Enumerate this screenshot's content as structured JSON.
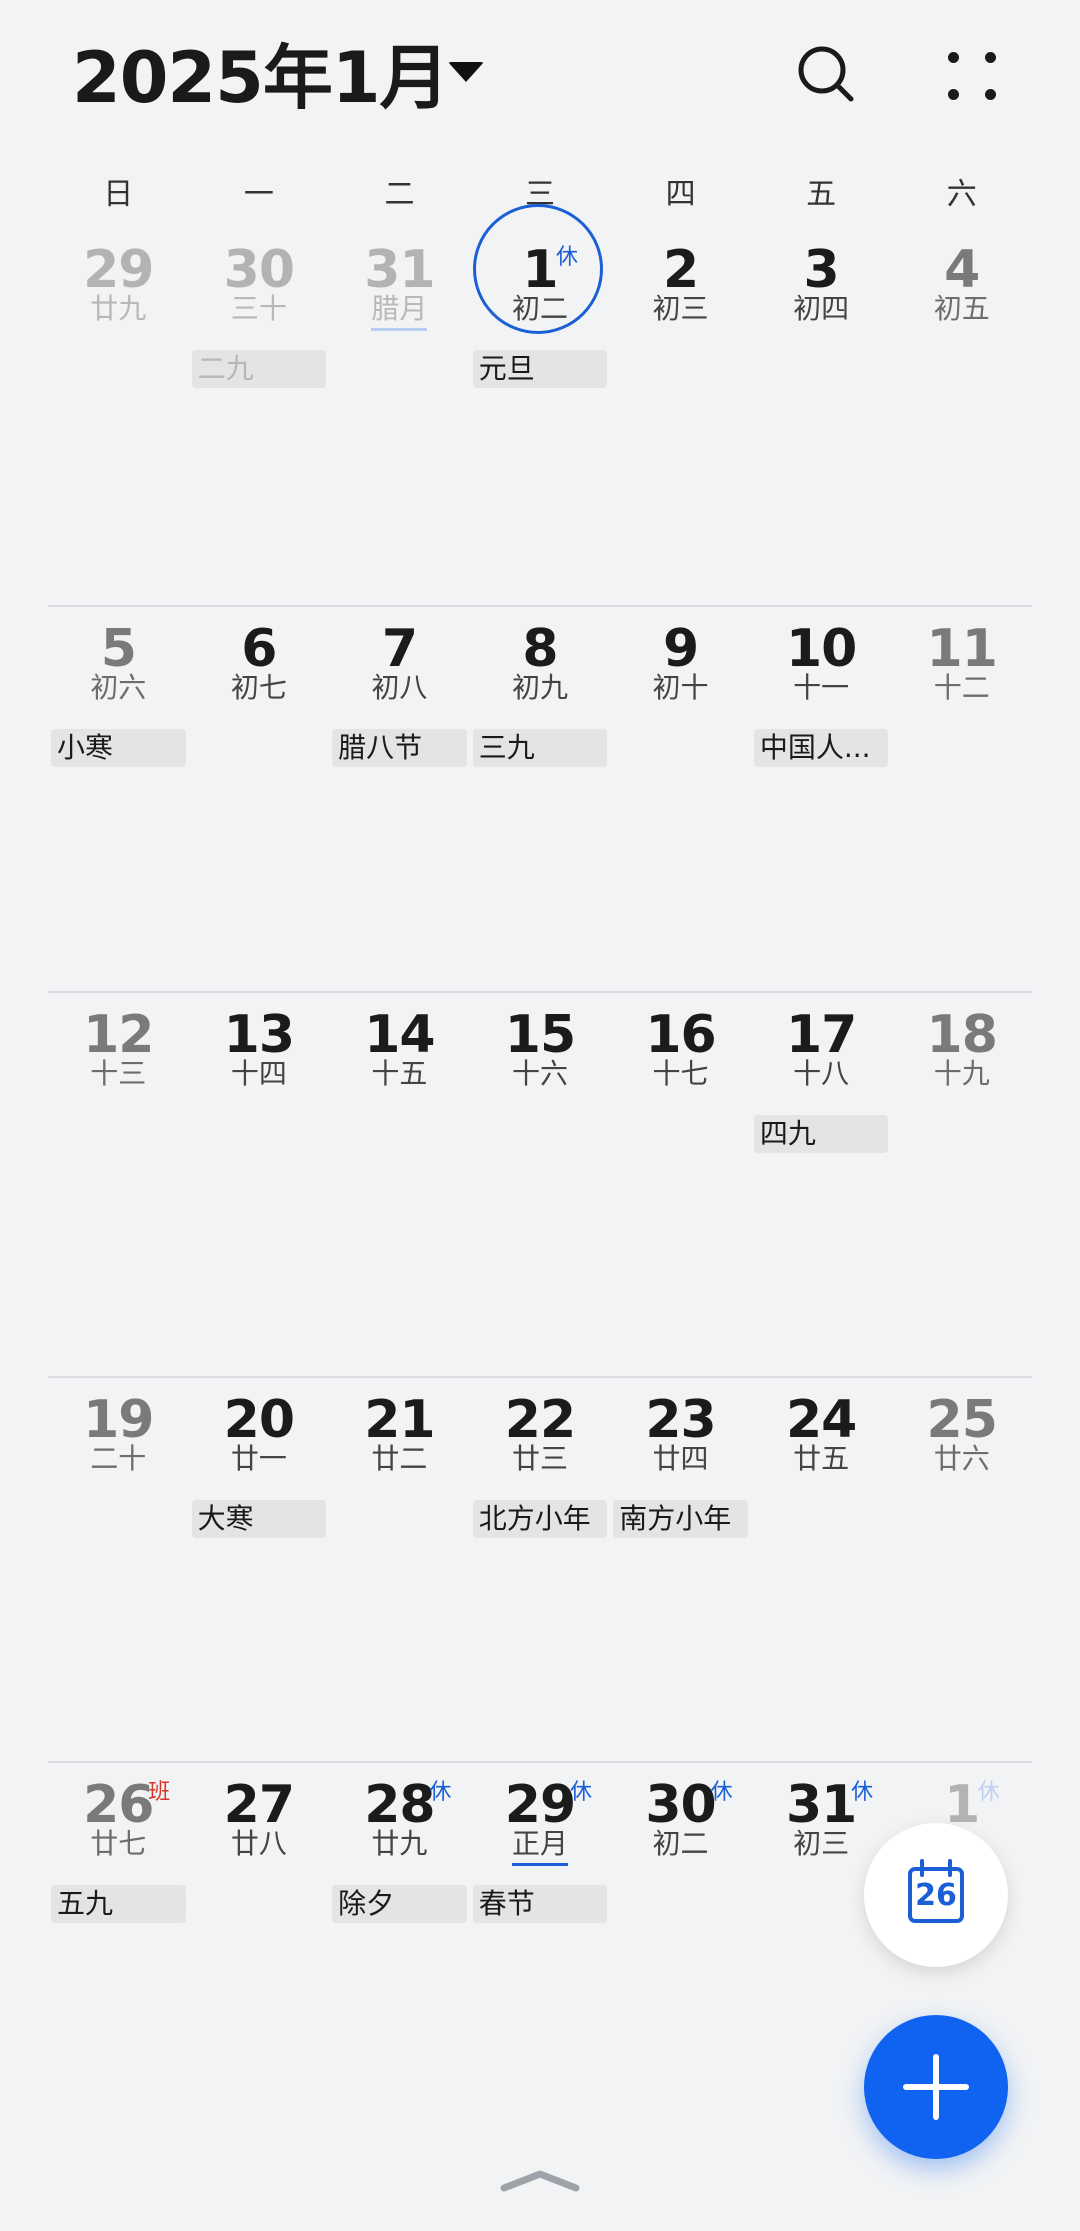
{
  "header": {
    "title": "2025年1月",
    "dropdown_icon": "triangle-down-icon",
    "search_icon": "search-icon",
    "more_icon": "four-dots-icon"
  },
  "weekdays": [
    "日",
    "一",
    "二",
    "三",
    "四",
    "五",
    "六"
  ],
  "weeks": [
    {
      "days": [
        {
          "num": "29",
          "lunar": "廿九",
          "dim": true
        },
        {
          "num": "30",
          "lunar": "三十",
          "dim": true
        },
        {
          "num": "31",
          "lunar": "腊月",
          "dim": true,
          "lunar_underline": "light"
        },
        {
          "num": "1",
          "lunar": "初二",
          "badge": "休",
          "today": true
        },
        {
          "num": "2",
          "lunar": "初三"
        },
        {
          "num": "3",
          "lunar": "初四"
        },
        {
          "num": "4",
          "lunar": "初五",
          "weekend": true
        }
      ],
      "events": [
        {
          "col": 1,
          "label": "二九",
          "dim": true
        },
        {
          "col": 3,
          "label": "元旦"
        }
      ]
    },
    {
      "days": [
        {
          "num": "5",
          "lunar": "初六",
          "weekend": true
        },
        {
          "num": "6",
          "lunar": "初七"
        },
        {
          "num": "7",
          "lunar": "初八"
        },
        {
          "num": "8",
          "lunar": "初九"
        },
        {
          "num": "9",
          "lunar": "初十"
        },
        {
          "num": "10",
          "lunar": "十一"
        },
        {
          "num": "11",
          "lunar": "十二",
          "weekend": true
        }
      ],
      "events": [
        {
          "col": 0,
          "label": "小寒"
        },
        {
          "col": 2,
          "label": "腊八节"
        },
        {
          "col": 3,
          "label": "三九"
        },
        {
          "col": 5,
          "label": "中国人..."
        }
      ]
    },
    {
      "days": [
        {
          "num": "12",
          "lunar": "十三",
          "weekend": true
        },
        {
          "num": "13",
          "lunar": "十四"
        },
        {
          "num": "14",
          "lunar": "十五"
        },
        {
          "num": "15",
          "lunar": "十六"
        },
        {
          "num": "16",
          "lunar": "十七"
        },
        {
          "num": "17",
          "lunar": "十八"
        },
        {
          "num": "18",
          "lunar": "十九",
          "weekend": true
        }
      ],
      "events": [
        {
          "col": 5,
          "label": "四九"
        }
      ]
    },
    {
      "days": [
        {
          "num": "19",
          "lunar": "二十",
          "weekend": true
        },
        {
          "num": "20",
          "lunar": "廿一"
        },
        {
          "num": "21",
          "lunar": "廿二"
        },
        {
          "num": "22",
          "lunar": "廿三"
        },
        {
          "num": "23",
          "lunar": "廿四"
        },
        {
          "num": "24",
          "lunar": "廿五"
        },
        {
          "num": "25",
          "lunar": "廿六",
          "weekend": true
        }
      ],
      "events": [
        {
          "col": 1,
          "label": "大寒"
        },
        {
          "col": 3,
          "label": "北方小年"
        },
        {
          "col": 4,
          "label": "南方小年"
        }
      ]
    },
    {
      "days": [
        {
          "num": "26",
          "lunar": "廿七",
          "weekend": true,
          "badge": "班",
          "badge_red": true
        },
        {
          "num": "27",
          "lunar": "廿八"
        },
        {
          "num": "28",
          "lunar": "廿九",
          "badge": "休"
        },
        {
          "num": "29",
          "lunar": "正月",
          "badge": "休",
          "lunar_underline": "strong"
        },
        {
          "num": "30",
          "lunar": "初二",
          "badge": "休"
        },
        {
          "num": "31",
          "lunar": "初三",
          "badge": "休"
        },
        {
          "num": "1",
          "lunar": "",
          "badge": "休",
          "dim": true,
          "badge_faint": true
        }
      ],
      "events": [
        {
          "col": 0,
          "label": "五九"
        },
        {
          "col": 2,
          "label": "除夕"
        },
        {
          "col": 3,
          "label": "春节"
        }
      ]
    }
  ],
  "fab_today": {
    "icon": "calendar-today-icon",
    "label": "26"
  },
  "fab_add": {
    "icon": "plus-icon"
  },
  "bottom_handle": {
    "icon": "chevron-up-icon"
  }
}
